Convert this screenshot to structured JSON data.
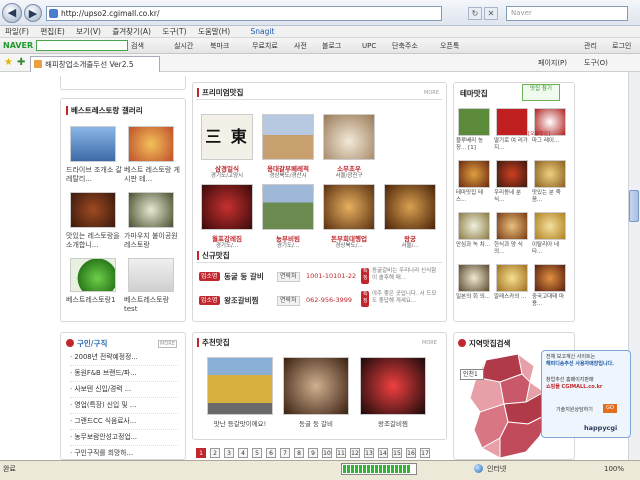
{
  "browser": {
    "url": "http://upso2.cgimall.co.kr/",
    "search_placeholder": "Naver",
    "menu": [
      "파일(F)",
      "편집(E)",
      "보기(V)",
      "즐겨찾기(A)",
      "도구(T)",
      "도움말(H)",
      "Snagit"
    ],
    "naver": {
      "logo": "NAVER",
      "search_label": "검색",
      "items": [
        "실시간",
        "북마크",
        "무료치료",
        "사전",
        "블로그",
        "UPC",
        "단축주소",
        "오픈툭"
      ],
      "right_items": [
        "관리",
        "로그인"
      ]
    },
    "tab_title": "해피창업소개출두선 Ver2.5",
    "commands": [
      "페이지(P)",
      "도구(O)"
    ]
  },
  "page": {
    "gallery": {
      "title": "베스트레스토랑 갤러리",
      "items": [
        {
          "caption": "드라이브 조개소 갈 레탈리..."
        },
        {
          "caption": "베스트 레스토랑 게시판 테..."
        },
        {
          "caption": "맛있는 레스토랑을 소개합니..."
        },
        {
          "caption": "가마우지 불이공원 레스토랑"
        },
        {
          "caption": "베스트레스토랑1"
        },
        {
          "caption": "베스트레스토랑 test"
        }
      ]
    },
    "premium": {
      "title": "프리미엄맛집",
      "more": "MORE",
      "row1": [
        {
          "name": "삼경일식",
          "area": "경기도/고양시"
        },
        {
          "name": "용대갈부페레적",
          "area": "경상북도/경산시"
        },
        {
          "name": "소무초우",
          "area": "서울/광진구"
        }
      ],
      "row2": [
        {
          "name": "월포강레짐",
          "area": "경기도/..."
        },
        {
          "name": "농부비빔",
          "area": "경기도/..."
        },
        {
          "name": "돈부회대행업",
          "area": "경상북도/..."
        },
        {
          "name": "왕궁",
          "area": "서울/..."
        }
      ],
      "sign_text": "三 東"
    },
    "new_shops": {
      "title": "신규맛집",
      "rows": [
        {
          "badge": "업소명",
          "name": "동굴 둥 갈비",
          "phone_label": "연락처",
          "phone": "1001-10101-22",
          "desc_badge": "특징",
          "desc": "동굴갈비는 우리나라 신식함이 솔후해 매..."
        },
        {
          "badge": "업소명",
          "name": "왕조갈비찜",
          "phone_label": "연락처",
          "phone": "062-956-3999",
          "desc_badge": "특징",
          "desc": "야주 좋은 곳입니다. 서 드모도 좋답해 게세요..."
        }
      ]
    },
    "theme": {
      "title": "테마맛집",
      "tab": "맛집 참기",
      "items": [
        "블루베리 농장... [1]",
        "딸기로 여 러가지...",
        "마그 레이...",
        "테마맛집 테스...",
        "우리동네 분식...",
        "맛있는 분 죽 음...",
        "안심과 녹 차...",
        "한식과 양 식의...",
        "이탈리아 네타...",
        "일본의 회 의...",
        "알래스카의 ...",
        "중국고대테 마용..."
      ],
      "extra": "[오삼명은]"
    },
    "jobs": {
      "title": "구인/구직",
      "more": "MORE",
      "items": [
        "2008년 전략예정정...",
        "동원F&B 브랜드/파...",
        "사보텐 신입/경력 ...",
        "영업(특장) 신입 및 ...",
        "그랜드CC 식음료사...",
        "농무보람안성고정업...",
        "구인구직를 희망하..."
      ]
    },
    "recommend": {
      "title": "추천맛집",
      "more": "MORE",
      "items": [
        {
          "caption": "맛난 등갈맛이에요!"
        },
        {
          "caption": "동굴 둥 갈비"
        },
        {
          "caption": "왕조갈비찜"
        }
      ]
    },
    "region": {
      "title": "지역맛집검색",
      "select_value": "인천1",
      "popup": {
        "line1": "전체 보고계신 사이트는",
        "line2": "해피디송추선 사용자매장입니다.",
        "line3": "창업추선 홈페이지판매",
        "line4": "쇼핑몰 CGIMALL.co.kr",
        "line5": "기술지원상담하기",
        "go": "GO",
        "brand": "happycgi"
      }
    },
    "pager": [
      "1",
      "2",
      "3",
      "4",
      "5",
      "6",
      "7",
      "8",
      "9",
      "10",
      "11",
      "12",
      "13",
      "14",
      "15",
      "16",
      "17"
    ]
  },
  "status": {
    "left": "완료",
    "zone": "인터넷",
    "zoom": "100%",
    "progress": 0.95
  },
  "colors": {
    "accent_red": "#c0272d",
    "naver_green": "#1f9a2e",
    "map_dark": "#b03a48",
    "map_light": "#e7a0a8"
  }
}
